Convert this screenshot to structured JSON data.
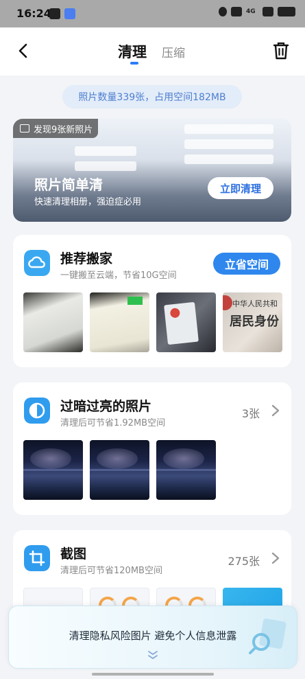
{
  "status_bar": {
    "time": "16:24",
    "network": "4G"
  },
  "header": {
    "tab_active": "清理",
    "tab_inactive": "压缩"
  },
  "summary": {
    "text": "照片数量339张，占用空间182MB"
  },
  "banner": {
    "badge": "发现9张新照片",
    "title": "照片简单清",
    "subtitle": "快速清理相册，强迫症必用",
    "button": "立即清理"
  },
  "cards": {
    "migrate": {
      "title": "推荐搬家",
      "subtitle": "一键搬至云端，节省10G空间",
      "button": "立省空间"
    },
    "exposure": {
      "title": "过暗过亮的照片",
      "subtitle": "清理后可节省1.92MB空间",
      "count": "3张"
    },
    "screenshots": {
      "title": "截图",
      "subtitle": "清理后可节省120MB空间",
      "count": "275张"
    }
  },
  "id_thumb": {
    "line1": "中华人民共和",
    "line2": "居民身份"
  },
  "bottom_banner": {
    "text": "清理隐私风险图片 避免个人信息泄露"
  },
  "colors": {
    "accent": "#2f87ee",
    "pill_bg": "#e3ecf9",
    "pill_text": "#4d7fce"
  }
}
